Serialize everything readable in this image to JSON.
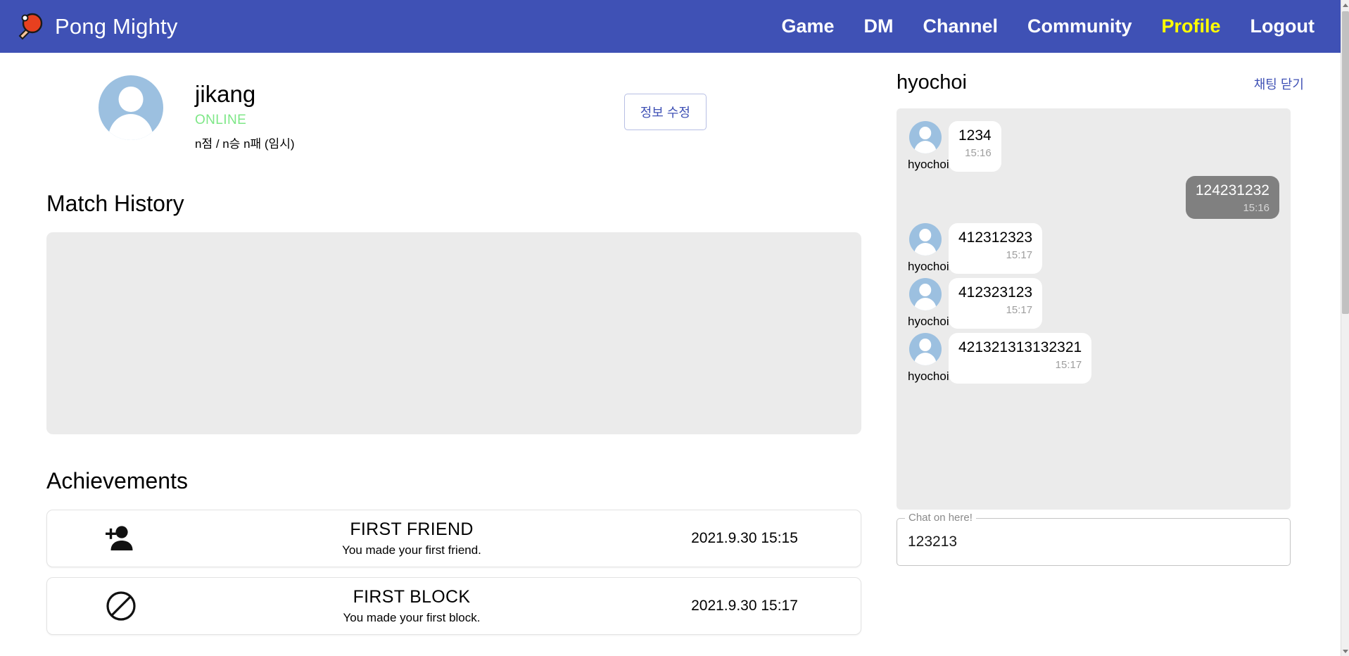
{
  "navbar": {
    "brand_title": "Pong Mighty",
    "brand_icon": "ping-pong-paddle-icon",
    "background_color": "#3f51b5",
    "active_color": "#ffff00",
    "links": [
      {
        "label": "Game",
        "active": false
      },
      {
        "label": "DM",
        "active": false
      },
      {
        "label": "Channel",
        "active": false
      },
      {
        "label": "Community",
        "active": false
      },
      {
        "label": "Profile",
        "active": true
      },
      {
        "label": "Logout",
        "active": false
      }
    ]
  },
  "profile": {
    "avatar_icon": "user-avatar-icon",
    "name": "jikang",
    "status": "ONLINE",
    "status_color": "#7ee787",
    "record": "n점 / n승 n패 (임시)",
    "edit_button_label": "정보 수정"
  },
  "match_history": {
    "title": "Match History",
    "entries": []
  },
  "achievements": {
    "title": "Achievements",
    "items": [
      {
        "icon": "person-add-icon",
        "name": "FIRST FRIEND",
        "description": "You made your first friend.",
        "date": "2021.9.30 15:15"
      },
      {
        "icon": "block-icon",
        "name": "FIRST BLOCK",
        "description": "You made your first block.",
        "date": "2021.9.30 15:17"
      }
    ]
  },
  "chat": {
    "peer_name": "hyochoi",
    "close_label": "채팅 닫기",
    "accent_color": "#3f51b5",
    "messages": [
      {
        "direction": "in",
        "sender": "hyochoi",
        "text": "1234",
        "time": "15:16"
      },
      {
        "direction": "out",
        "sender": "",
        "text": "124231232",
        "time": "15:16"
      },
      {
        "direction": "in",
        "sender": "hyochoi",
        "text": "412312323",
        "time": "15:17"
      },
      {
        "direction": "in",
        "sender": "hyochoi",
        "text": "412323123",
        "time": "15:17"
      },
      {
        "direction": "in",
        "sender": "hyochoi",
        "text": "421321313132321",
        "time": "15:17"
      }
    ],
    "input": {
      "label": "Chat on here!",
      "value": "123213",
      "placeholder": "Chat on here!"
    }
  }
}
